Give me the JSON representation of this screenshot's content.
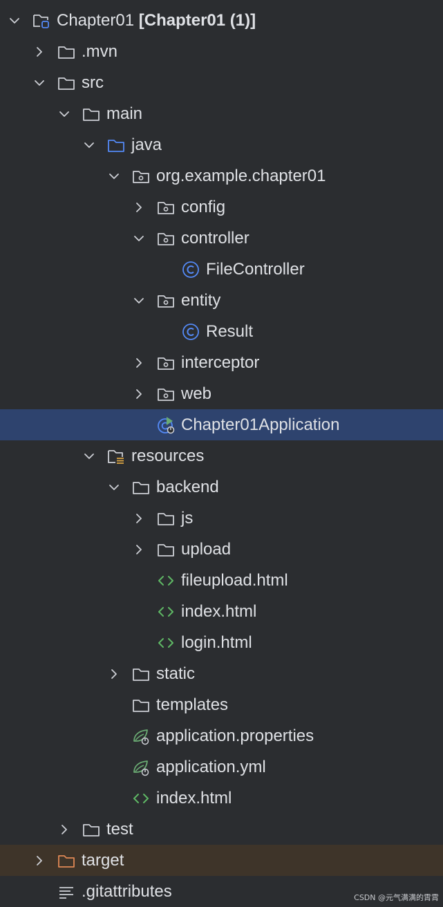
{
  "colors": {
    "background": "#2b2d30",
    "text": "#dfe1e5",
    "selected_row": "#2e436e",
    "excluded_row": "#3e3429",
    "folder_stroke": "#ced0d6",
    "source_folder": "#548af7",
    "excluded_folder": "#e08855",
    "html_icon": "#5fb865",
    "class_icon": "#548af7",
    "spring_icon": "#6aab73"
  },
  "tree": [
    {
      "name": "Chapter01",
      "suffix": "[Chapter01 (1)]",
      "level": 0,
      "expanded": true,
      "icon": "module-folder-icon"
    },
    {
      "name": ".mvn",
      "level": 1,
      "expanded": false,
      "icon": "folder-icon"
    },
    {
      "name": "src",
      "level": 1,
      "expanded": true,
      "icon": "folder-icon"
    },
    {
      "name": "main",
      "level": 2,
      "expanded": true,
      "icon": "folder-icon"
    },
    {
      "name": "java",
      "level": 3,
      "expanded": true,
      "icon": "source-folder-icon"
    },
    {
      "name": "org.example.chapter01",
      "level": 4,
      "expanded": true,
      "icon": "package-icon"
    },
    {
      "name": "config",
      "level": 5,
      "expanded": false,
      "icon": "package-icon"
    },
    {
      "name": "controller",
      "level": 5,
      "expanded": true,
      "icon": "package-icon"
    },
    {
      "name": "FileController",
      "level": 6,
      "leaf": true,
      "icon": "class-icon"
    },
    {
      "name": "entity",
      "level": 5,
      "expanded": true,
      "icon": "package-icon"
    },
    {
      "name": "Result",
      "level": 6,
      "leaf": true,
      "icon": "class-icon"
    },
    {
      "name": "interceptor",
      "level": 5,
      "expanded": false,
      "icon": "package-icon"
    },
    {
      "name": "web",
      "level": 5,
      "expanded": false,
      "icon": "package-icon"
    },
    {
      "name": "Chapter01Application",
      "level": 5,
      "leaf": true,
      "icon": "spring-boot-class-icon",
      "selected": true
    },
    {
      "name": "resources",
      "level": 3,
      "expanded": true,
      "icon": "resources-folder-icon"
    },
    {
      "name": "backend",
      "level": 4,
      "expanded": true,
      "icon": "folder-icon"
    },
    {
      "name": "js",
      "level": 5,
      "expanded": false,
      "icon": "folder-icon"
    },
    {
      "name": "upload",
      "level": 5,
      "expanded": false,
      "icon": "folder-icon"
    },
    {
      "name": "fileupload.html",
      "level": 5,
      "leaf": true,
      "icon": "html-icon"
    },
    {
      "name": "index.html",
      "level": 5,
      "leaf": true,
      "icon": "html-icon"
    },
    {
      "name": "login.html",
      "level": 5,
      "leaf": true,
      "icon": "html-icon"
    },
    {
      "name": "static",
      "level": 4,
      "expanded": false,
      "icon": "folder-icon"
    },
    {
      "name": "templates",
      "level": 4,
      "leaf": true,
      "icon": "folder-icon"
    },
    {
      "name": "application.properties",
      "level": 4,
      "leaf": true,
      "icon": "spring-config-icon"
    },
    {
      "name": "application.yml",
      "level": 4,
      "leaf": true,
      "icon": "spring-config-icon"
    },
    {
      "name": "index.html",
      "level": 4,
      "leaf": true,
      "icon": "html-icon"
    },
    {
      "name": "test",
      "level": 2,
      "expanded": false,
      "icon": "folder-icon"
    },
    {
      "name": "target",
      "level": 1,
      "expanded": false,
      "icon": "excluded-folder-icon",
      "excluded": true
    },
    {
      "name": ".gitattributes",
      "level": 1,
      "leaf": true,
      "icon": "text-file-icon"
    }
  ],
  "watermark": "CSDN @元气满满的霄霄"
}
